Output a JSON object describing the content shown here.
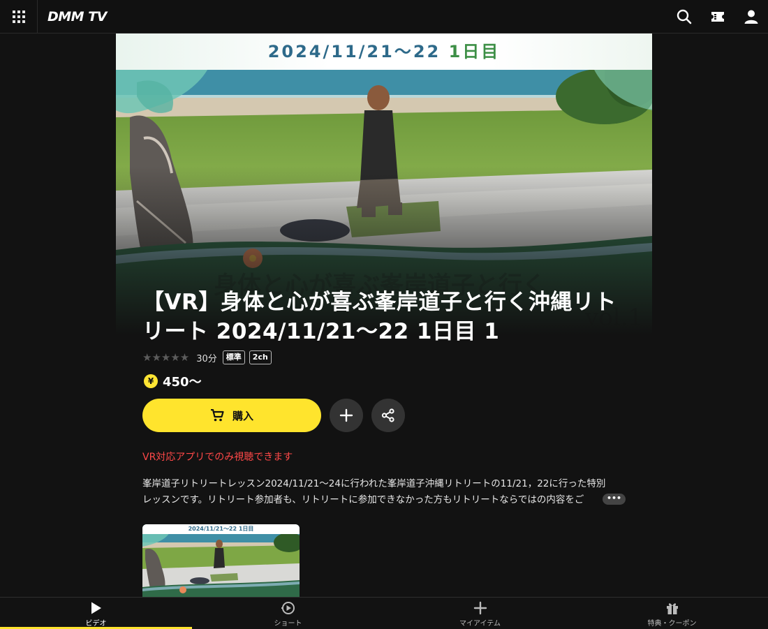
{
  "header": {
    "logo_text": "DMM TV",
    "icons": [
      "grid-icon",
      "search-icon",
      "ticket-icon",
      "user-icon"
    ]
  },
  "hero": {
    "banner_date": "2024/11/21～22",
    "banner_day": "1日目",
    "title": "【VR】身体と心が喜ぶ峯岸道子と行く沖縄リトリート 2024/11/21～22 1日目 1"
  },
  "meta": {
    "stars": "★★★★★",
    "duration": "30分",
    "badge_quality": "標準",
    "badge_audio": "2ch"
  },
  "price": {
    "currency_symbol": "¥",
    "value": "450～"
  },
  "actions": {
    "buy_label": "購入"
  },
  "vr_note": "VR対応アプリでのみ視聴できます",
  "description": {
    "line1": "峯岸道子リトリートレッスン2024/11/21～24に行われた峯岸道子沖縄リトリートの11/21，22に行った特別",
    "line2": "レッスンです。リトリート参加者も、リトリートに参加できなかった方もリトリートならではの内容をご",
    "more_label": "•••"
  },
  "thumbnail": {
    "banner": "2024/11/21～22 1日目"
  },
  "bottom_nav": {
    "items": [
      {
        "label": "ビデオ",
        "icon": "play-icon",
        "active": true
      },
      {
        "label": "ショート",
        "icon": "short-icon",
        "active": false
      },
      {
        "label": "マイアイテム",
        "icon": "plus-icon",
        "active": false
      },
      {
        "label": "特典・クーポン",
        "icon": "gift-icon",
        "active": false
      }
    ]
  },
  "colors": {
    "accent": "#ffe42d",
    "background": "#121212",
    "vr_note": "#ff4848"
  }
}
